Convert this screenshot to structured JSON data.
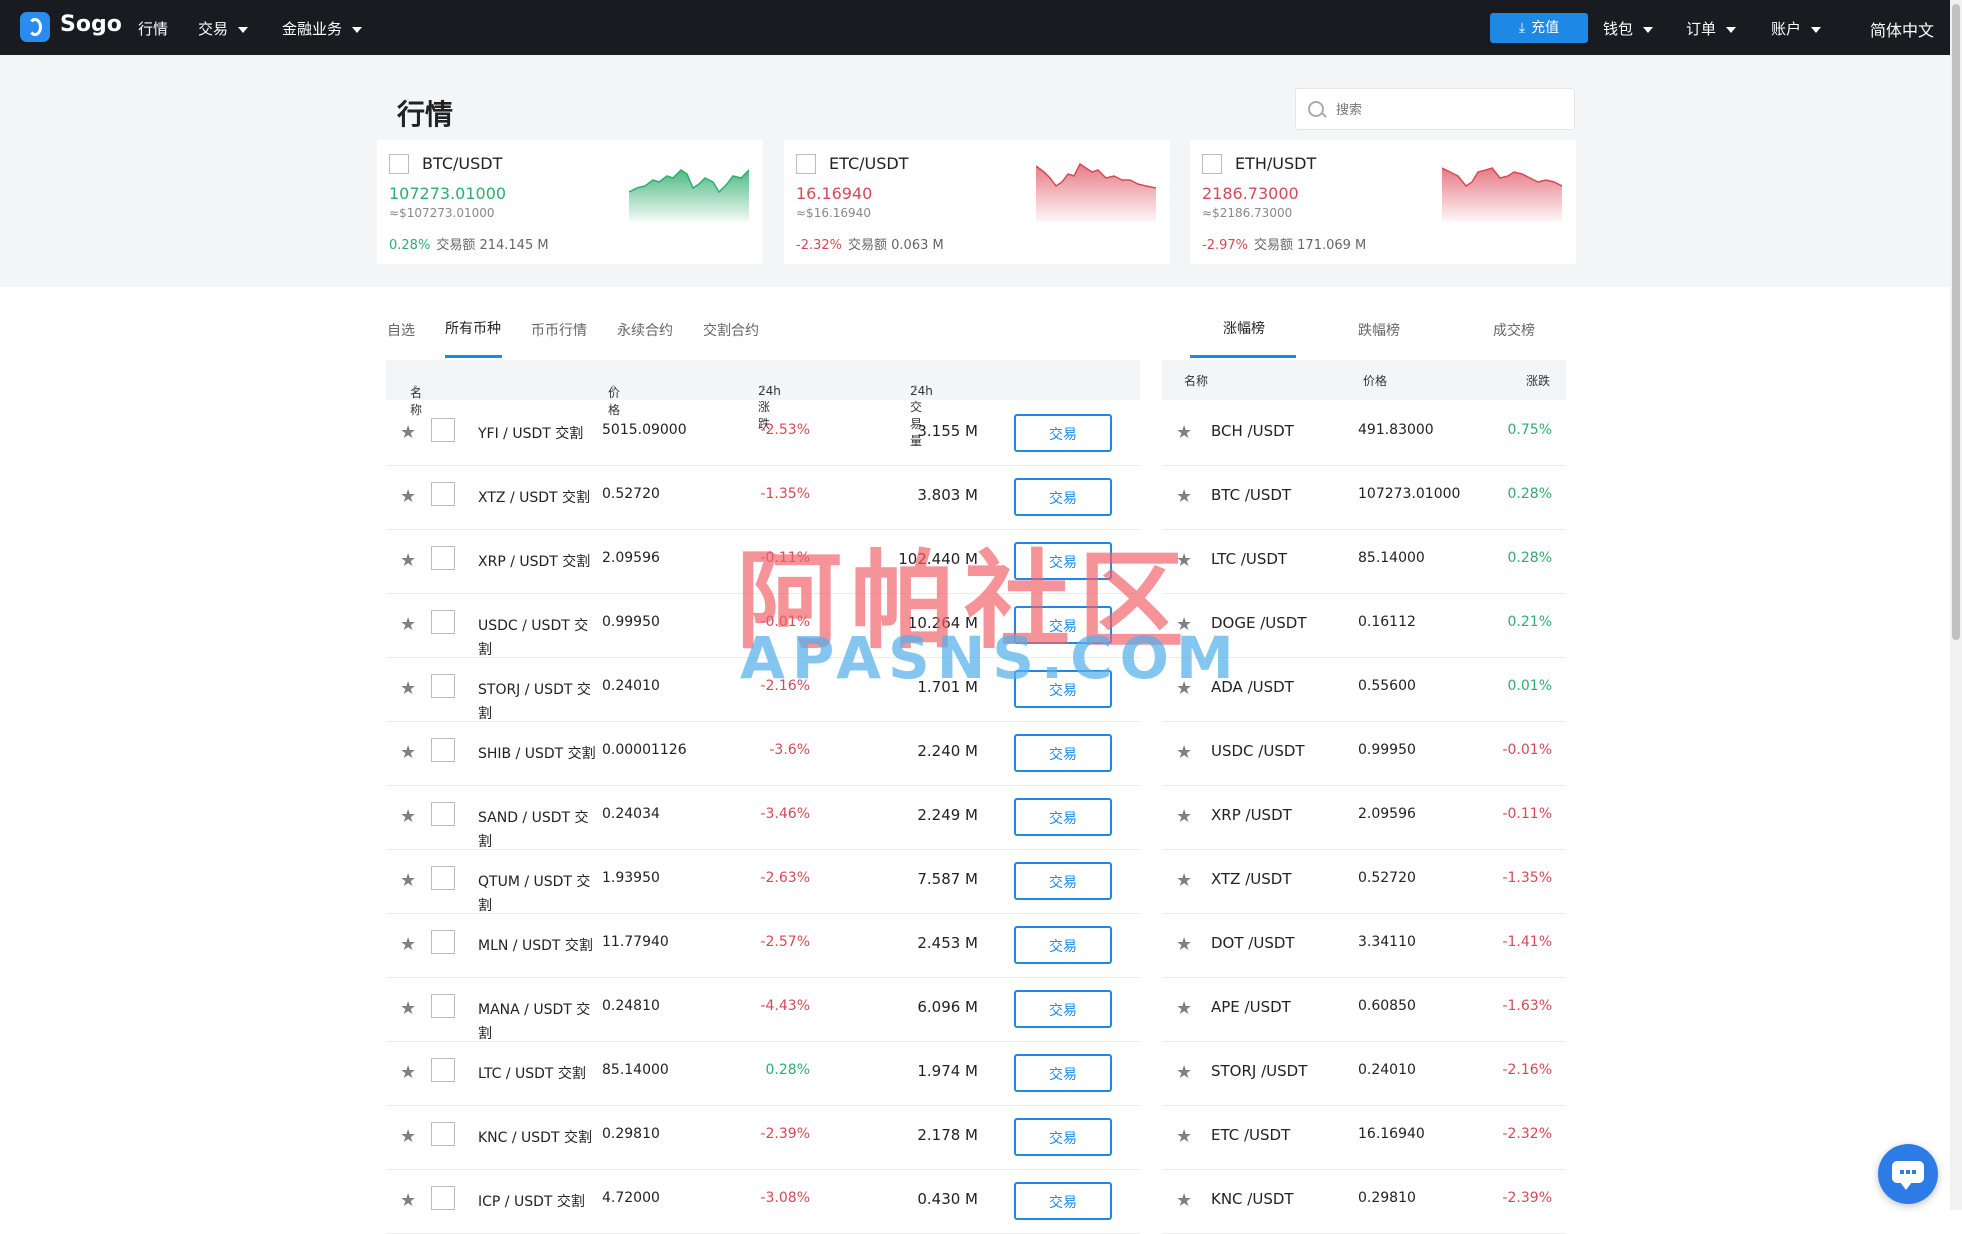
{
  "brand": "Sogo",
  "nav": {
    "market": "行情",
    "trade": "交易",
    "finance": "金融业务"
  },
  "header": {
    "deposit": "充值",
    "wallet": "钱包",
    "orders": "订单",
    "account": "账户",
    "language": "简体中文"
  },
  "page": {
    "title": "行情",
    "search_placeholder": "搜索"
  },
  "colors": {
    "up": "#2eae6e",
    "down": "#d64857",
    "accent": "#1e88e5",
    "topbar": "#1a1b20"
  },
  "cards": [
    {
      "pair": "BTC/USDT",
      "price": "107273.01000",
      "usd": "≈$107273.01000",
      "change": "0.28%",
      "volume_label": "交易额",
      "volume": "214.145 M",
      "trend": "up"
    },
    {
      "pair": "ETC/USDT",
      "price": "16.16940",
      "usd": "≈$16.16940",
      "change": "-2.32%",
      "volume_label": "交易额",
      "volume": "0.063 M",
      "trend": "down"
    },
    {
      "pair": "ETH/USDT",
      "price": "2186.73000",
      "usd": "≈$2186.73000",
      "change": "-2.97%",
      "volume_label": "交易额",
      "volume": "171.069 M",
      "trend": "down"
    }
  ],
  "tabs": [
    "自选",
    "所有币种",
    "币币行情",
    "永续合约",
    "交割合约"
  ],
  "rank_tabs": [
    "涨幅榜",
    "跌幅榜",
    "成交榜"
  ],
  "table_headers": {
    "name": "名称",
    "price": "价格",
    "change": "24h涨跌",
    "volume": "24h交易量"
  },
  "rank_headers": {
    "name": "名称",
    "price": "价格",
    "change": "涨跌"
  },
  "trade_label": "交易",
  "rows": [
    {
      "name": "YFI / USDT 交割",
      "price": "5015.09000",
      "change": "-2.53%",
      "volume": "3.155 M",
      "trend": "down"
    },
    {
      "name": "XTZ / USDT 交割",
      "price": "0.52720",
      "change": "-1.35%",
      "volume": "3.803 M",
      "trend": "down"
    },
    {
      "name": "XRP / USDT 交割",
      "price": "2.09596",
      "change": "-0.11%",
      "volume": "102.440 M",
      "trend": "down"
    },
    {
      "name": "USDC / USDT 交割",
      "price": "0.99950",
      "change": "-0.01%",
      "volume": "10.264 M",
      "trend": "down"
    },
    {
      "name": "STORJ / USDT 交割",
      "price": "0.24010",
      "change": "-2.16%",
      "volume": "1.701 M",
      "trend": "down"
    },
    {
      "name": "SHIB / USDT 交割",
      "price": "0.00001126",
      "change": "-3.6%",
      "volume": "2.240 M",
      "trend": "down"
    },
    {
      "name": "SAND / USDT 交割",
      "price": "0.24034",
      "change": "-3.46%",
      "volume": "2.249 M",
      "trend": "down"
    },
    {
      "name": "QTUM / USDT 交割",
      "price": "1.93950",
      "change": "-2.63%",
      "volume": "7.587 M",
      "trend": "down"
    },
    {
      "name": "MLN / USDT 交割",
      "price": "11.77940",
      "change": "-2.57%",
      "volume": "2.453 M",
      "trend": "down"
    },
    {
      "name": "MANA / USDT 交割",
      "price": "0.24810",
      "change": "-4.43%",
      "volume": "6.096 M",
      "trend": "down"
    },
    {
      "name": "LTC / USDT 交割",
      "price": "85.14000",
      "change": "0.28%",
      "volume": "1.974 M",
      "trend": "up"
    },
    {
      "name": "KNC / USDT 交割",
      "price": "0.29810",
      "change": "-2.39%",
      "volume": "2.178 M",
      "trend": "down"
    },
    {
      "name": "ICP / USDT 交割",
      "price": "4.72000",
      "change": "-3.08%",
      "volume": "0.430 M",
      "trend": "down"
    }
  ],
  "rank_rows": [
    {
      "pair": "BCH /USDT",
      "price": "491.83000",
      "change": "0.75%",
      "trend": "up"
    },
    {
      "pair": "BTC /USDT",
      "price": "107273.01000",
      "change": "0.28%",
      "trend": "up"
    },
    {
      "pair": "LTC /USDT",
      "price": "85.14000",
      "change": "0.28%",
      "trend": "up"
    },
    {
      "pair": "DOGE /USDT",
      "price": "0.16112",
      "change": "0.21%",
      "trend": "up"
    },
    {
      "pair": "ADA /USDT",
      "price": "0.55600",
      "change": "0.01%",
      "trend": "up"
    },
    {
      "pair": "USDC /USDT",
      "price": "0.99950",
      "change": "-0.01%",
      "trend": "down"
    },
    {
      "pair": "XRP /USDT",
      "price": "2.09596",
      "change": "-0.11%",
      "trend": "down"
    },
    {
      "pair": "XTZ /USDT",
      "price": "0.52720",
      "change": "-1.35%",
      "trend": "down"
    },
    {
      "pair": "DOT /USDT",
      "price": "3.34110",
      "change": "-1.41%",
      "trend": "down"
    },
    {
      "pair": "APE /USDT",
      "price": "0.60850",
      "change": "-1.63%",
      "trend": "down"
    },
    {
      "pair": "STORJ /USDT",
      "price": "0.24010",
      "change": "-2.16%",
      "trend": "down"
    },
    {
      "pair": "ETC /USDT",
      "price": "16.16940",
      "change": "-2.32%",
      "trend": "down"
    },
    {
      "pair": "KNC /USDT",
      "price": "0.29810",
      "change": "-2.39%",
      "trend": "down"
    }
  ],
  "watermark": {
    "cn": "阿帕社区",
    "en": "APASNS.COM"
  }
}
